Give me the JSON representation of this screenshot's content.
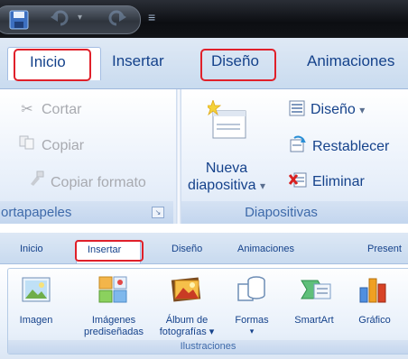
{
  "top_panel": {
    "tabs": [
      {
        "label": "Inicio",
        "active": true,
        "highlighted": true
      },
      {
        "label": "Insertar",
        "active": false,
        "highlighted": false
      },
      {
        "label": "Diseño",
        "active": false,
        "highlighted": true
      },
      {
        "label": "Animaciones",
        "active": false,
        "highlighted": false
      }
    ],
    "clipboard_group": {
      "label": "ortapapeles",
      "commands": [
        {
          "label": "Cortar",
          "icon": "scissors-icon",
          "enabled": false
        },
        {
          "label": "Copiar",
          "icon": "copy-icon",
          "enabled": false
        },
        {
          "label": "Copiar formato",
          "icon": "format-painter-icon",
          "enabled": false
        }
      ]
    },
    "slides_group": {
      "label": "Diapositivas",
      "new_slide": {
        "line1": "Nueva",
        "line2": "diapositiva",
        "arrow": "▾"
      },
      "commands": [
        {
          "label": "Diseño",
          "arrow": "▾",
          "icon": "layout-icon"
        },
        {
          "label": "Restablecer",
          "icon": "reset-icon"
        },
        {
          "label": "Eliminar",
          "icon": "delete-icon"
        }
      ]
    }
  },
  "bottom_panel": {
    "tabs": [
      {
        "label": "Inicio",
        "active": false
      },
      {
        "label": "Insertar",
        "active": true,
        "highlighted": true
      },
      {
        "label": "Diseño",
        "active": false
      },
      {
        "label": "Animaciones",
        "active": false
      },
      {
        "label": "Present",
        "active": false
      }
    ],
    "illustrations_group": {
      "label": "Ilustraciones",
      "buttons": [
        {
          "line1": "Imagen",
          "line2": "",
          "icon": "picture-icon"
        },
        {
          "line1": "Imágenes",
          "line2": "prediseñadas",
          "icon": "clipart-icon"
        },
        {
          "line1": "Álbum de",
          "line2": "fotografías ▾",
          "icon": "photo-album-icon"
        },
        {
          "line1": "Formas",
          "line2": "▾",
          "icon": "shapes-icon"
        },
        {
          "line1": "SmartArt",
          "line2": "",
          "icon": "smartart-icon"
        },
        {
          "line1": "Gráfico",
          "line2": "",
          "icon": "chart-icon"
        }
      ]
    }
  },
  "colors": {
    "tab_text": "#15428b",
    "highlight": "#e0202a",
    "disabled_text": "#a8aab0",
    "group_label": "#3e6aaa"
  }
}
